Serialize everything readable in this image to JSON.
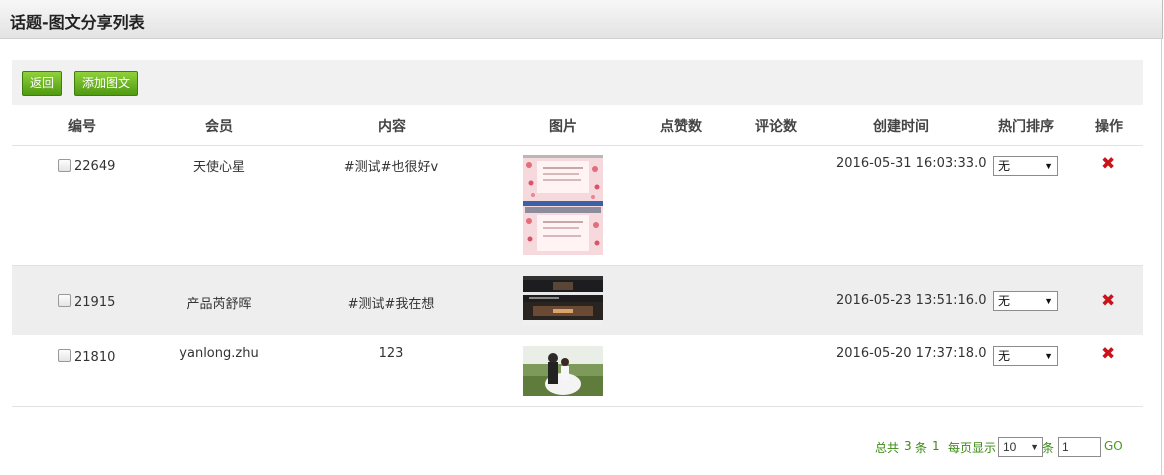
{
  "header": {
    "title": "话题-图文分享列表"
  },
  "toolbar": {
    "back_label": "返回",
    "add_label": "添加图文"
  },
  "columns": [
    "编号",
    "会员",
    "内容",
    "图片",
    "点赞数",
    "评论数",
    "创建时间",
    "热门排序",
    "操作"
  ],
  "rows": [
    {
      "id": "22649",
      "member": "天使心星",
      "content": "#测试#也很好v",
      "likes": "",
      "comments": "",
      "created": "2016-05-31 16:03:33.0",
      "hot": "无",
      "image": "pink-hearts-screenshot"
    },
    {
      "id": "21915",
      "member": "产品芮舒晖",
      "content": "#测试#我在想",
      "likes": "",
      "comments": "",
      "created": "2016-05-23 13:51:16.0",
      "hot": "无",
      "image": "dark-webpage-screenshot"
    },
    {
      "id": "21810",
      "member": "yanlong.zhu",
      "content": "123",
      "likes": "",
      "comments": "",
      "created": "2016-05-20 17:37:18.0",
      "hot": "无",
      "image": "wedding-photo"
    }
  ],
  "pager": {
    "total_prefix": "总共",
    "total_count": "3",
    "total_unit": "条",
    "current_page": "1",
    "per_page_label": "每页显示",
    "per_page_value": "10",
    "per_page_unit": "条",
    "page_input": "1",
    "go_label": "GO"
  },
  "icons": {
    "delete": "delete-x-icon"
  },
  "colors": {
    "button": "#5ea91a",
    "delete": "#c8141a",
    "pager": "#3a8a14"
  }
}
